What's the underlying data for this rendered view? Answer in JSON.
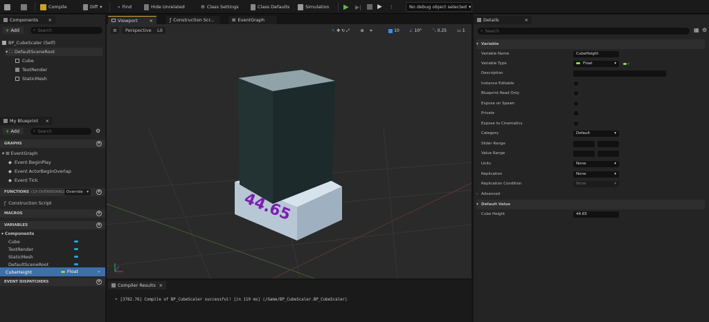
{
  "toolbar": {
    "compile": "Compile",
    "diff": "Diff",
    "find": "Find",
    "hide_unrelated": "Hide Unrelated",
    "class_settings": "Class Settings",
    "class_defaults": "Class Defaults",
    "simulation": "Simulation",
    "debug_object": "No debug object selected"
  },
  "components": {
    "tab": "Components",
    "add": "Add",
    "search_placeholder": "Search",
    "tree": [
      {
        "label": "BP_CubeScaler (Self)"
      },
      {
        "label": "DefaultSceneRoot"
      },
      {
        "label": "Cube"
      },
      {
        "label": "TextRender"
      },
      {
        "label": "StaticMesh"
      }
    ]
  },
  "my_blueprint": {
    "tab": "My Blueprint",
    "add": "Add",
    "search_placeholder": "Search",
    "graphs_header": "GRAPHS",
    "event_graph": "EventGraph",
    "events": [
      "Event BeginPlay",
      "Event ActorBeginOverlap",
      "Event Tick"
    ],
    "functions_header": "FUNCTIONS",
    "functions_count": "(19 OVERRIDABLE)",
    "override": "Override",
    "construction_script": "Construction Script",
    "macros_header": "MACROS",
    "variables_header": "VARIABLES",
    "components_group": "Components",
    "component_vars": [
      "Cube",
      "TextRender",
      "StaticMesh",
      "DefaultSceneRoot"
    ],
    "selected_var": "CubeHeight",
    "selected_var_type": "Float",
    "dispatchers_header": "EVENT DISPATCHERS"
  },
  "viewport": {
    "tabs": [
      "Viewport",
      "Construction Scr...",
      "EventGraph"
    ],
    "perspective": "Perspective",
    "lit": "Lit",
    "grid_snap": "10",
    "rot_snap": "10°",
    "scale_snap": "0.25",
    "camera_speed": "1",
    "render_text": "44.65"
  },
  "compiler": {
    "tab": "Compiler Results",
    "message": "[3782.76] Compile of BP_CubeScaler successful! [in 119 ms] (/Game/BP_CubeScaler.BP_CubeScaler)"
  },
  "details": {
    "tab": "Details",
    "search_placeholder": "Search",
    "variable_section": "Variable",
    "variable_name_label": "Variable Name",
    "variable_name": "CubeHeight",
    "variable_type_label": "Variable Type",
    "variable_type": "Float",
    "description_label": "Description",
    "instance_editable": "Instance Editable",
    "blueprint_read_only": "Blueprint Read Only",
    "expose_on_spawn": "Expose on Spawn",
    "private": "Private",
    "expose_to_cinematics": "Expose to Cinematics",
    "category_label": "Category",
    "category": "Default",
    "slider_range": "Slider Range",
    "value_range": "Value Range",
    "units_label": "Units",
    "units": "None",
    "replication_label": "Replication",
    "replication": "None",
    "replication_condition_label": "Replication Condition",
    "replication_condition": "None",
    "advanced": "Advanced",
    "default_value_section": "Default Value",
    "cube_height_label": "Cube Height",
    "cube_height_value": "44.65"
  },
  "colors": {
    "accent_green": "#5bc236",
    "float_green": "#8be03a",
    "component_blue": "#22a6d8",
    "text_purple": "#7a1fb0"
  }
}
